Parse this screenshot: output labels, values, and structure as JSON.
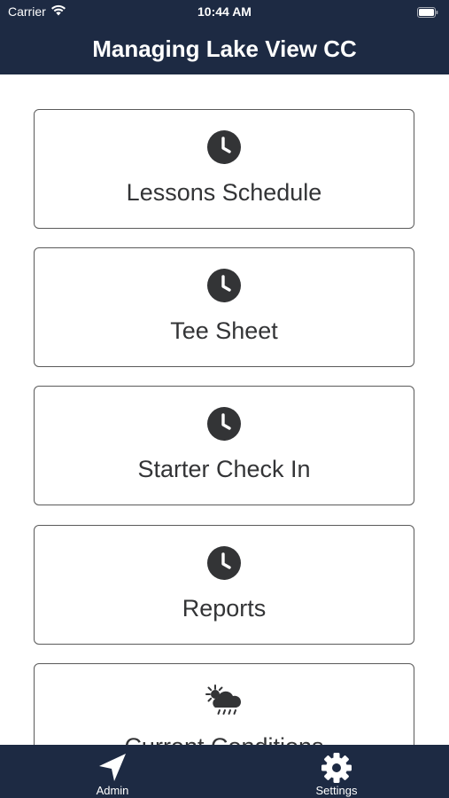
{
  "status_bar": {
    "carrier": "Carrier",
    "time": "10:44 AM",
    "wifi_icon": "wifi-icon",
    "battery_icon": "battery-icon"
  },
  "header": {
    "title": "Managing Lake View CC"
  },
  "menu": {
    "items": [
      {
        "label": "Lessons Schedule",
        "icon": "clock-icon"
      },
      {
        "label": "Tee Sheet",
        "icon": "clock-icon"
      },
      {
        "label": "Starter Check In",
        "icon": "clock-icon"
      },
      {
        "label": "Reports",
        "icon": "clock-icon"
      },
      {
        "label": "Current Conditions",
        "icon": "weather-icon"
      }
    ]
  },
  "tab_bar": {
    "items": [
      {
        "label": "Admin",
        "icon": "location-arrow-icon"
      },
      {
        "label": "Settings",
        "icon": "gear-icon"
      }
    ]
  },
  "colors": {
    "header_bg": "#1d2a43",
    "tab_bar_bg": "#1d2a43",
    "icon": "#333436",
    "card_border": "#5a5a5a",
    "text": "#333436"
  }
}
